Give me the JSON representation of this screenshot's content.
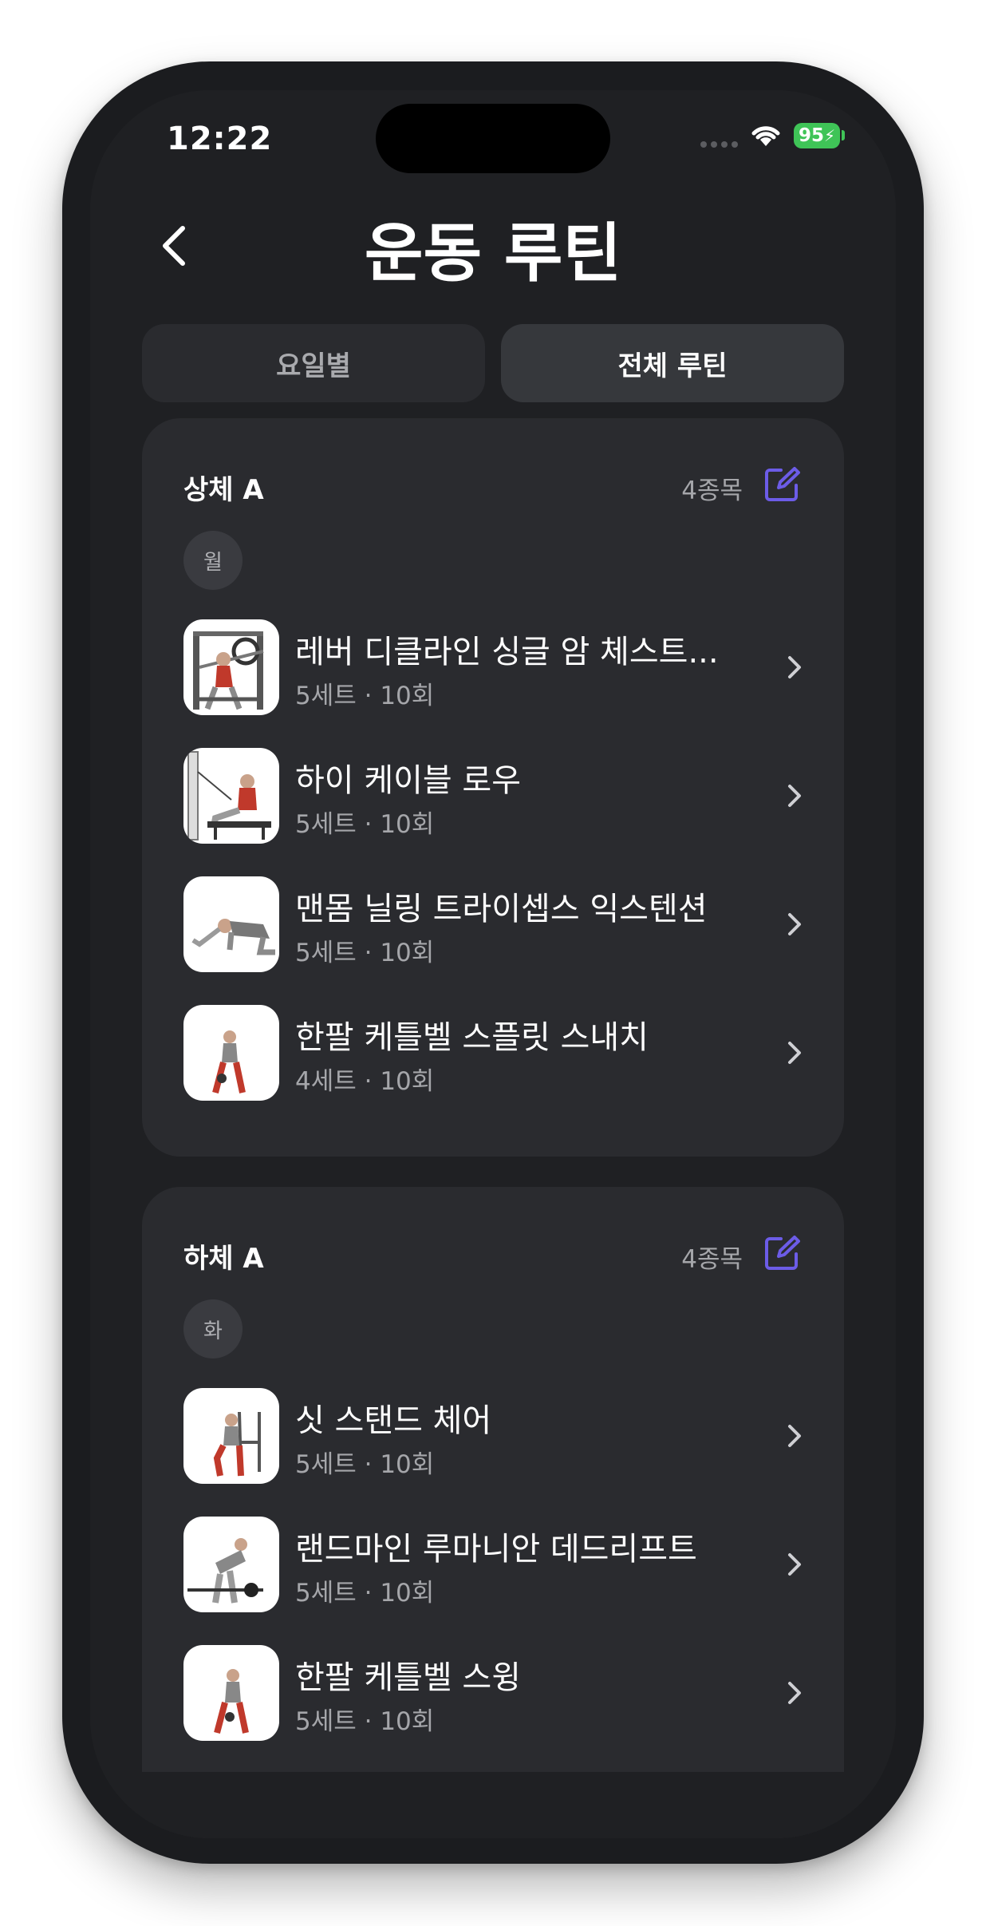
{
  "status_bar": {
    "time": "12:22",
    "battery": "95"
  },
  "header": {
    "title": "운동 루틴"
  },
  "tabs": [
    {
      "label": "요일별",
      "selected": false
    },
    {
      "label": "전체 루틴",
      "selected": true
    }
  ],
  "routines": [
    {
      "title": "상체 A",
      "count": "4종목",
      "day": "월",
      "exercises": [
        {
          "name": "레버 디클라인 싱글 암 체스트...",
          "meta": "5세트 · 10회"
        },
        {
          "name": "하이 케이블 로우",
          "meta": "5세트 · 10회"
        },
        {
          "name": "맨몸 닐링 트라이셉스 익스텐션",
          "meta": "5세트 · 10회"
        },
        {
          "name": "한팔 케틀벨 스플릿 스내치",
          "meta": "4세트 · 10회"
        }
      ]
    },
    {
      "title": "하체 A",
      "count": "4종목",
      "day": "화",
      "exercises": [
        {
          "name": "싯 스탠드 체어",
          "meta": "5세트 · 10회"
        },
        {
          "name": "랜드마인 루마니안 데드리프트",
          "meta": "5세트 · 10회"
        },
        {
          "name": "한팔 케틀벨 스윙",
          "meta": "5세트 · 10회"
        }
      ]
    }
  ],
  "colors": {
    "accent": "#6c5ce7",
    "background": "#1f2023",
    "card": "#2a2b2f"
  }
}
